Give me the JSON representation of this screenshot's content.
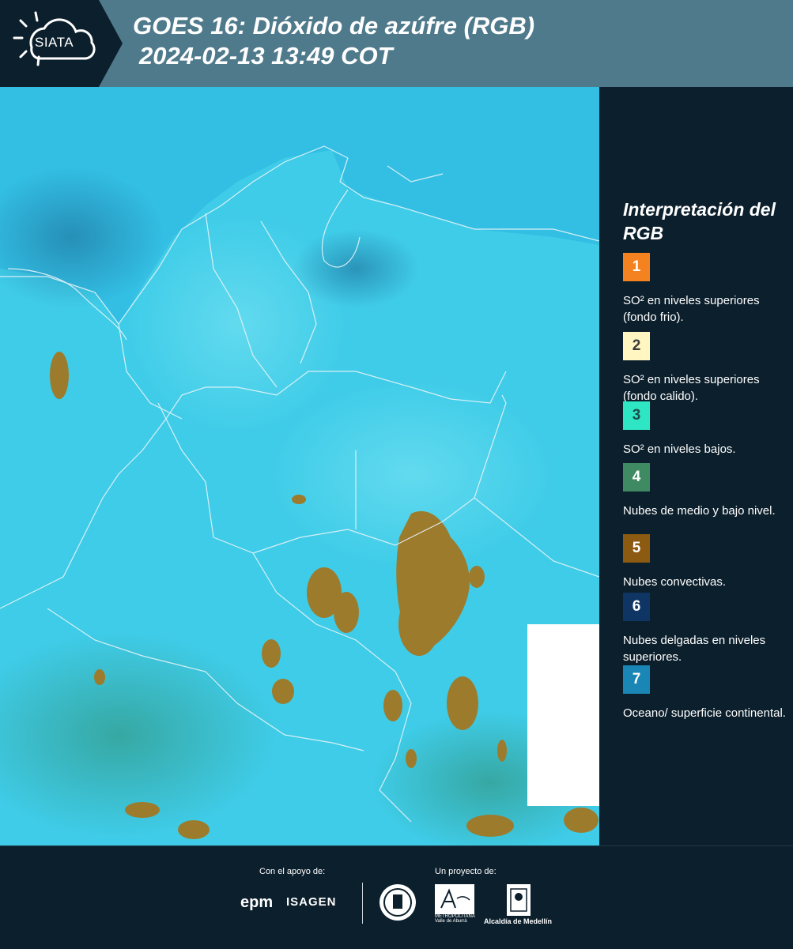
{
  "header": {
    "title_line1": "GOES 16: Dióxido de azúfre (RGB)",
    "title_line2": "2024-02-13 13:49 COT",
    "logo_text": "SIATA",
    "header_color": "#4f7a8b",
    "logo_bg_color": "#0c1f2c"
  },
  "legend": {
    "title": "Interpretación del RGB",
    "items": [
      {
        "number": "1",
        "label": "SO² en niveles superiores (fondo frio).",
        "color": "#f58220"
      },
      {
        "number": "2",
        "label": "SO² en niveles superiores (fondo calido).",
        "color": "#fff6c2"
      },
      {
        "number": "3",
        "label": "SO² en niveles bajos.",
        "color": "#2ee6c4"
      },
      {
        "number": "4",
        "label": "Nubes de medio y bajo nivel.",
        "color": "#3f8a62"
      },
      {
        "number": "5",
        "label": "Nubes convectivas.",
        "color": "#8c5a10"
      },
      {
        "number": "6",
        "label": "Nubes delgadas en niveles superiores.",
        "color": "#0f3564"
      },
      {
        "number": "7",
        "label": "Oceano/ superficie continental.",
        "color": "#1a86b5"
      }
    ]
  },
  "map": {
    "ocean_color": "#2fb6e0",
    "land_color": "#3fd0e8",
    "convective_color": "#9a7a2c",
    "border_color": "#e8f4f8",
    "missing_data_color": "#ffffff"
  },
  "footer": {
    "support_label": "Con el apoyo de:",
    "project_label": "Un proyecto de:",
    "sponsor_epm": "epm",
    "sponsor_isagen": "ISAGEN",
    "area_text": "METROPOLITANA Valle de Aburrá",
    "alcaldia_text": "Alcaldía de Medellín"
  }
}
